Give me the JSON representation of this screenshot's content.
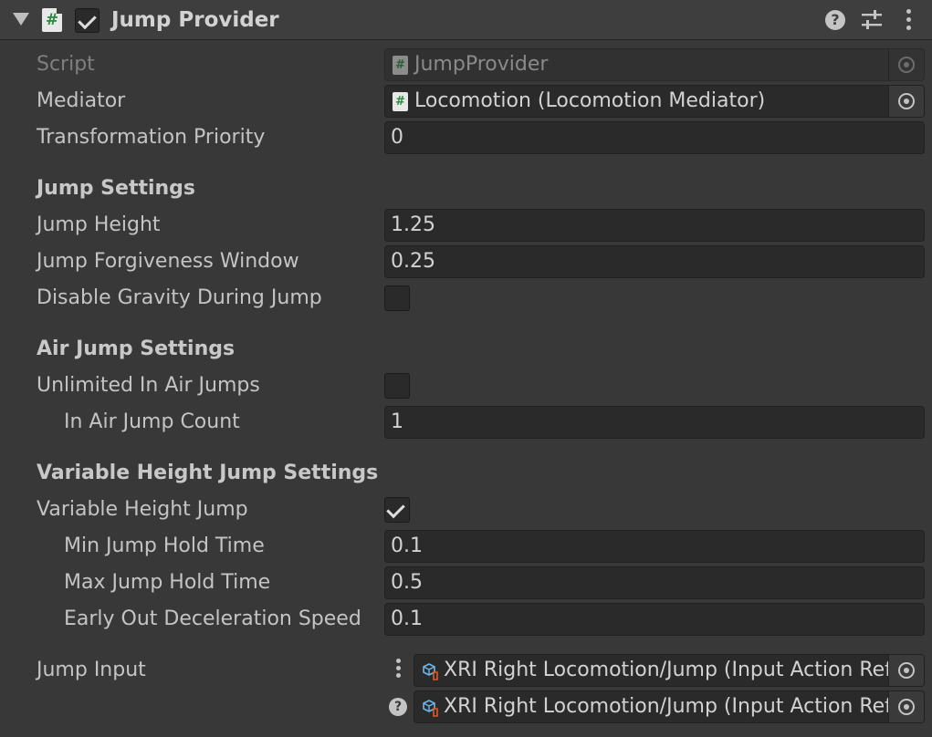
{
  "header": {
    "title": "Jump Provider",
    "script_glyph": "#",
    "enabled": true,
    "help_glyph": "?"
  },
  "fields": {
    "script": {
      "label": "Script",
      "value": "JumpProvider"
    },
    "mediator": {
      "label": "Mediator",
      "value": "Locomotion (Locomotion Mediator)"
    },
    "transformation_priority": {
      "label": "Transformation Priority",
      "value": "0"
    }
  },
  "jump_settings": {
    "header": "Jump Settings",
    "jump_height": {
      "label": "Jump Height",
      "value": "1.25"
    },
    "jump_forgiveness_window": {
      "label": "Jump Forgiveness Window",
      "value": "0.25"
    },
    "disable_gravity": {
      "label": "Disable Gravity During Jump",
      "checked": false
    }
  },
  "air_jump_settings": {
    "header": "Air Jump Settings",
    "unlimited_in_air_jumps": {
      "label": "Unlimited In Air Jumps",
      "checked": false
    },
    "in_air_jump_count": {
      "label": "In Air Jump Count",
      "value": "1"
    }
  },
  "variable_height_settings": {
    "header": "Variable Height Jump Settings",
    "variable_height_jump": {
      "label": "Variable Height Jump",
      "checked": true
    },
    "min_jump_hold_time": {
      "label": "Min Jump Hold Time",
      "value": "0.1"
    },
    "max_jump_hold_time": {
      "label": "Max Jump Hold Time",
      "value": "0.5"
    },
    "early_out_deceleration_speed": {
      "label": "Early Out Deceleration Speed",
      "value": "0.1"
    }
  },
  "jump_input": {
    "label": "Jump Input",
    "primary": "XRI Right Locomotion/Jump (Input Action Reference)",
    "secondary": "XRI Right Locomotion/Jump (Input Action Reference)",
    "help_glyph": "?"
  },
  "colors": {
    "background": "#383838",
    "header": "#3e3e3e",
    "field": "#2a2a2a",
    "text": "#c4c4c4",
    "script_icon_green": "#2b8a3e"
  }
}
